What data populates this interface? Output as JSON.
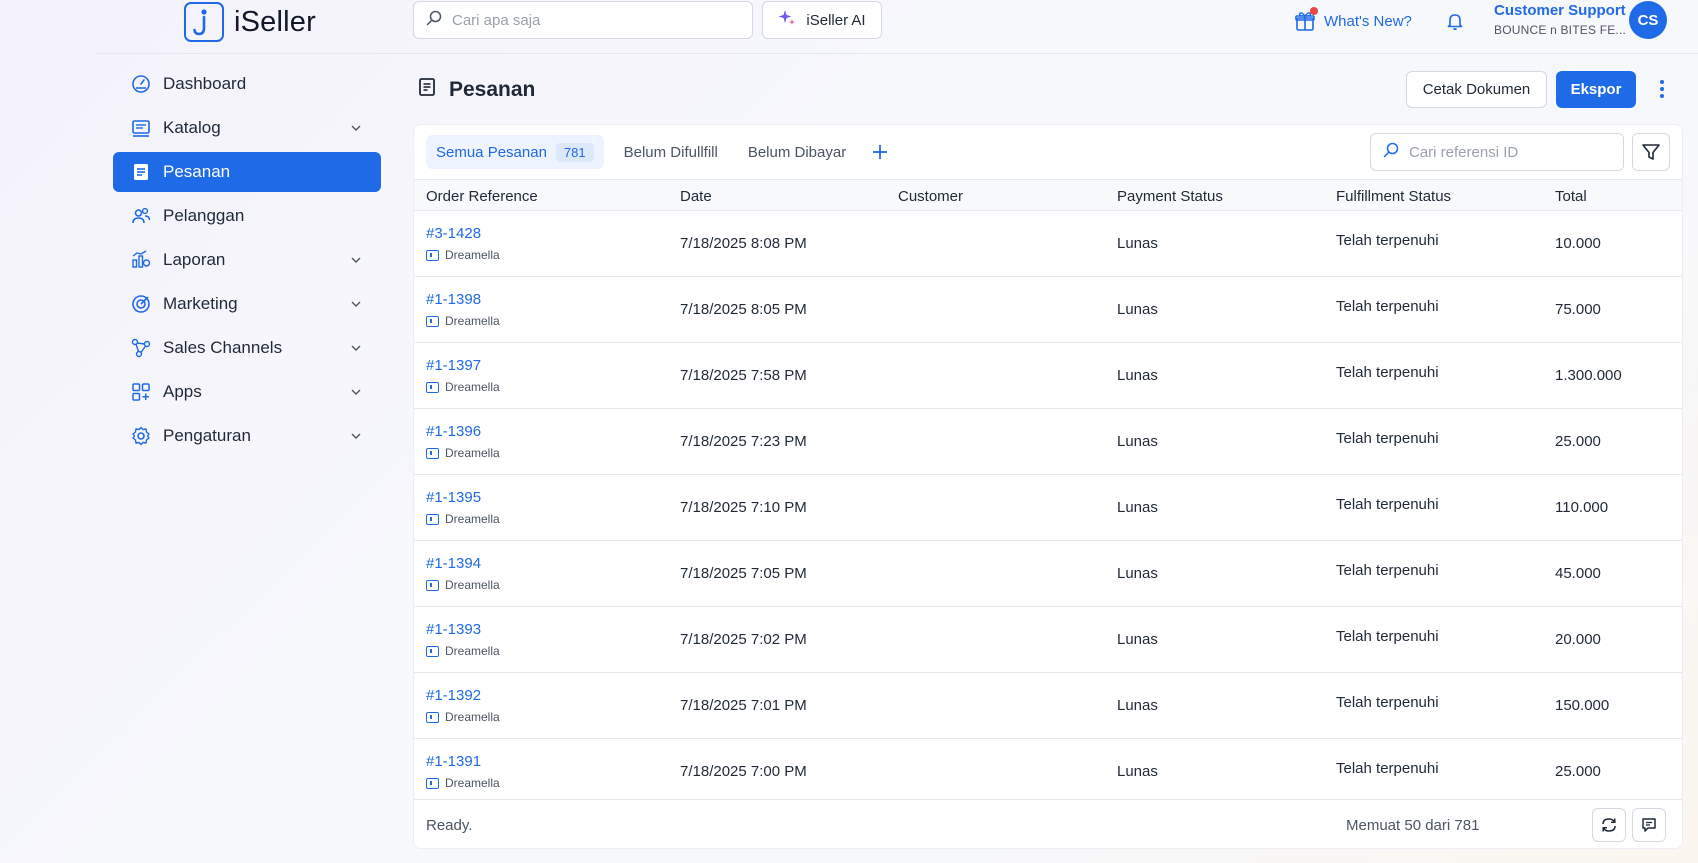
{
  "app": {
    "name": "iSeller"
  },
  "header": {
    "search_placeholder": "Cari apa saja",
    "ai_button": "iSeller AI",
    "whats_new": "What's New?",
    "user": {
      "name": "Customer Support",
      "store": "BOUNCE n BITES FE...",
      "initials": "CS"
    }
  },
  "sidebar": {
    "items": [
      {
        "label": "Dashboard",
        "icon": "dashboard-icon"
      },
      {
        "label": "Katalog",
        "icon": "catalog-icon"
      },
      {
        "label": "Pesanan",
        "icon": "orders-icon"
      },
      {
        "label": "Pelanggan",
        "icon": "customers-icon"
      },
      {
        "label": "Laporan",
        "icon": "reports-icon"
      },
      {
        "label": "Marketing",
        "icon": "marketing-icon"
      },
      {
        "label": "Sales Channels",
        "icon": "sales-channels-icon"
      },
      {
        "label": "Apps",
        "icon": "apps-icon"
      },
      {
        "label": "Pengaturan",
        "icon": "settings-icon"
      }
    ]
  },
  "page": {
    "title": "Pesanan",
    "print_button": "Cetak Dokumen",
    "export_button": "Ekspor"
  },
  "tabs": [
    {
      "label": "Semua Pesanan",
      "count": "781"
    },
    {
      "label": "Belum Difullfill"
    },
    {
      "label": "Belum Dibayar"
    }
  ],
  "ref_search_placeholder": "Cari referensi ID",
  "table": {
    "columns": [
      "Order Reference",
      "Date",
      "Customer",
      "Payment Status",
      "Fulfillment Status",
      "Total"
    ],
    "rows": [
      {
        "ref": "#3-1428",
        "store": "Dreamella",
        "date": "7/18/2025 8:08 PM",
        "customer": "",
        "payment": "Lunas",
        "fulfillment": "Telah terpenuhi",
        "total": "10.000"
      },
      {
        "ref": "#1-1398",
        "store": "Dreamella",
        "date": "7/18/2025 8:05 PM",
        "customer": "",
        "payment": "Lunas",
        "fulfillment": "Telah terpenuhi",
        "total": "75.000"
      },
      {
        "ref": "#1-1397",
        "store": "Dreamella",
        "date": "7/18/2025 7:58 PM",
        "customer": "",
        "payment": "Lunas",
        "fulfillment": "Telah terpenuhi",
        "total": "1.300.000"
      },
      {
        "ref": "#1-1396",
        "store": "Dreamella",
        "date": "7/18/2025 7:23 PM",
        "customer": "",
        "payment": "Lunas",
        "fulfillment": "Telah terpenuhi",
        "total": "25.000"
      },
      {
        "ref": "#1-1395",
        "store": "Dreamella",
        "date": "7/18/2025 7:10 PM",
        "customer": "",
        "payment": "Lunas",
        "fulfillment": "Telah terpenuhi",
        "total": "110.000"
      },
      {
        "ref": "#1-1394",
        "store": "Dreamella",
        "date": "7/18/2025 7:05 PM",
        "customer": "",
        "payment": "Lunas",
        "fulfillment": "Telah terpenuhi",
        "total": "45.000"
      },
      {
        "ref": "#1-1393",
        "store": "Dreamella",
        "date": "7/18/2025 7:02 PM",
        "customer": "",
        "payment": "Lunas",
        "fulfillment": "Telah terpenuhi",
        "total": "20.000"
      },
      {
        "ref": "#1-1392",
        "store": "Dreamella",
        "date": "7/18/2025 7:01 PM",
        "customer": "",
        "payment": "Lunas",
        "fulfillment": "Telah terpenuhi",
        "total": "150.000"
      },
      {
        "ref": "#1-1391",
        "store": "Dreamella",
        "date": "7/18/2025 7:00 PM",
        "customer": "",
        "payment": "Lunas",
        "fulfillment": "Telah terpenuhi",
        "total": "25.000"
      }
    ]
  },
  "footer": {
    "status": "Ready.",
    "loaded": "Memuat 50 dari 781"
  },
  "colors": {
    "accent": "#1f6ae6",
    "notification": "#ef4444"
  }
}
